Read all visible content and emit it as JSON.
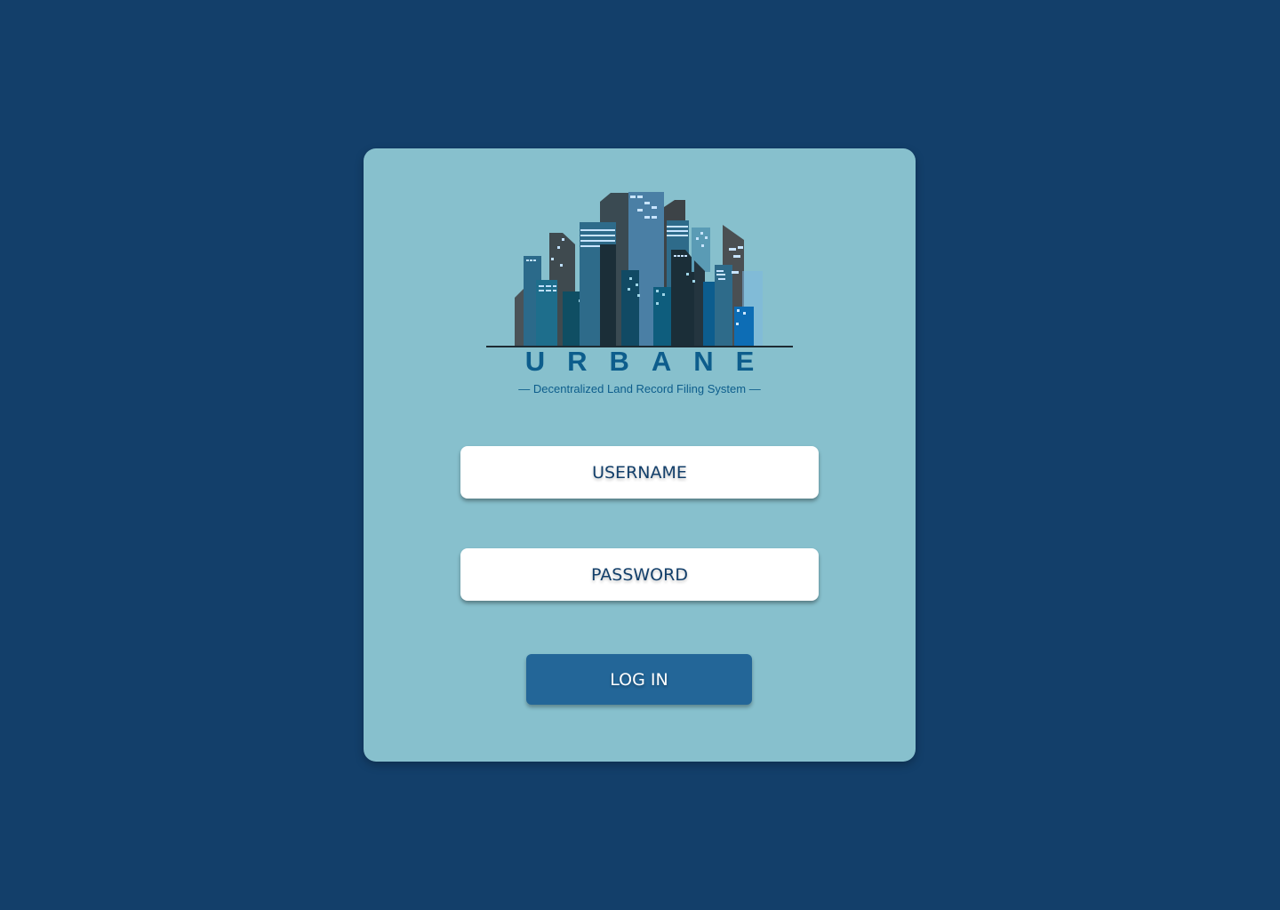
{
  "brand": {
    "name": "URBANE",
    "tagline": "— Decentralized Land Record Filing System —",
    "logo_icon": "city-skyline-icon"
  },
  "form": {
    "username_placeholder": "USERNAME",
    "password_placeholder": "PASSWORD",
    "login_label": "LOG IN"
  },
  "colors": {
    "background": "#133f6a",
    "card": "#87c0cd",
    "brand_text": "#0d5d8c",
    "button": "#236698",
    "input_text": "#133f6a"
  }
}
